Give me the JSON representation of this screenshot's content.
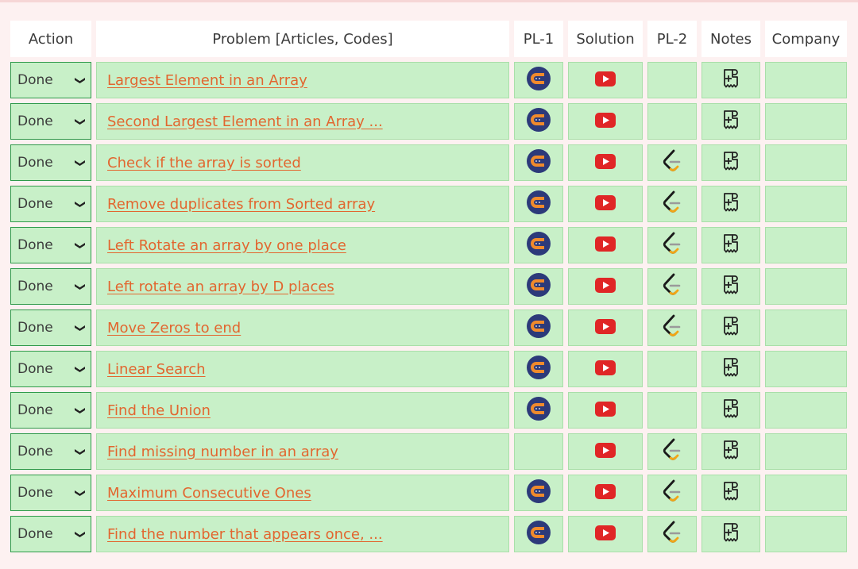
{
  "headers": {
    "action": "Action",
    "problem": "Problem [Articles, Codes]",
    "pl1": "PL-1",
    "solution": "Solution",
    "pl2": "PL-2",
    "notes": "Notes",
    "company": "Company"
  },
  "rows": [
    {
      "action": "Done",
      "problem": "Largest Element in an Array",
      "pl1": true,
      "pl2": false
    },
    {
      "action": "Done",
      "problem": "Second Largest Element in an Array ...",
      "pl1": true,
      "pl2": false
    },
    {
      "action": "Done",
      "problem": "Check if the array is sorted",
      "pl1": true,
      "pl2": true
    },
    {
      "action": "Done",
      "problem": "Remove duplicates from Sorted array",
      "pl1": true,
      "pl2": true
    },
    {
      "action": "Done",
      "problem": "Left Rotate an array by one place",
      "pl1": true,
      "pl2": true
    },
    {
      "action": "Done",
      "problem": "Left rotate an array by D places",
      "pl1": true,
      "pl2": true
    },
    {
      "action": "Done",
      "problem": "Move Zeros to end",
      "pl1": true,
      "pl2": true
    },
    {
      "action": "Done",
      "problem": "Linear Search",
      "pl1": true,
      "pl2": false
    },
    {
      "action": "Done",
      "problem": "Find the Union",
      "pl1": true,
      "pl2": false
    },
    {
      "action": "Done",
      "problem": "Find missing number in an array",
      "pl1": false,
      "pl2": true
    },
    {
      "action": "Done",
      "problem": "Maximum Consecutive Ones",
      "pl1": true,
      "pl2": true
    },
    {
      "action": "Done",
      "problem": "Find the number that appears once, ...",
      "pl1": true,
      "pl2": true
    }
  ],
  "icons": {
    "pl1": "coding-ninjas-icon",
    "solution": "youtube-icon",
    "pl2": "leetcode-icon",
    "notes": "add-note-icon",
    "dropdown": "chevron-down-icon"
  },
  "colors": {
    "row_bg": "#c8f0c8",
    "link": "#e2662f",
    "youtube": "#e02626",
    "ninja_outer": "#2c3a7a",
    "ninja_inner": "#f08a2c"
  }
}
